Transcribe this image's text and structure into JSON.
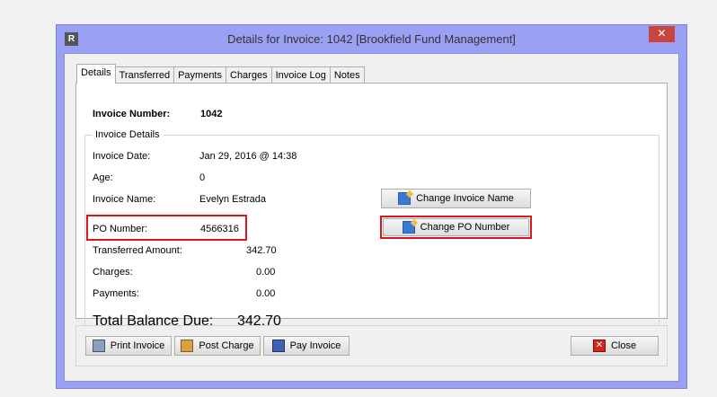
{
  "window": {
    "title": "Details for Invoice: 1042 [Brookfield Fund Management]",
    "app_icon_letter": "R",
    "close_glyph": "✕"
  },
  "tabs": [
    {
      "label": "Details",
      "active": true
    },
    {
      "label": "Transferred",
      "active": false
    },
    {
      "label": "Payments",
      "active": false
    },
    {
      "label": "Charges",
      "active": false
    },
    {
      "label": "Invoice Log",
      "active": false
    },
    {
      "label": "Notes",
      "active": false
    }
  ],
  "details": {
    "invoice_number_label": "Invoice Number:",
    "invoice_number_value": "1042",
    "group_title": "Invoice Details",
    "invoice_date_label": "Invoice Date:",
    "invoice_date_value": "Jan 29, 2016 @ 14:38",
    "age_label": "Age:",
    "age_value": "0",
    "invoice_name_label": "Invoice Name:",
    "invoice_name_value": "Evelyn Estrada",
    "po_number_label": "PO Number:",
    "po_number_value": "4566316",
    "transferred_label": "Transferred Amount:",
    "transferred_value": "342.70",
    "charges_label": "Charges:",
    "charges_value": "0.00",
    "payments_label": "Payments:",
    "payments_value": "0.00",
    "total_label": "Total Balance Due:",
    "total_value": "342.70",
    "change_invoice_name_button": "Change Invoice Name",
    "change_po_number_button": "Change PO Number"
  },
  "footer": {
    "print_invoice": "Print Invoice",
    "post_charge": "Post Charge",
    "pay_invoice": "Pay Invoice",
    "close": "Close"
  },
  "colors": {
    "window_frame": "#9aa0f4",
    "highlight": "#e0141e",
    "close_button": "#c9463d"
  }
}
